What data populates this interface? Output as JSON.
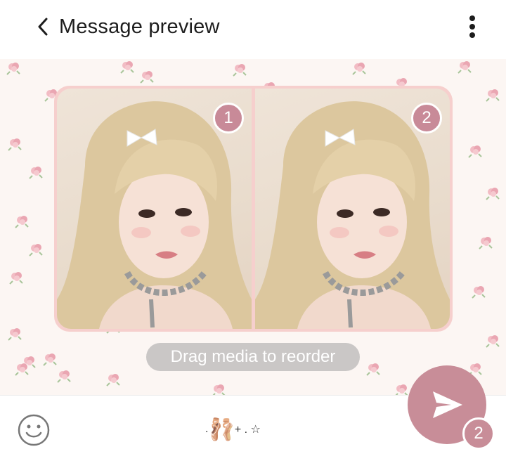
{
  "header": {
    "back_icon": "chevron-left-icon",
    "title": "Message preview",
    "menu_icon": "more-vertical-icon"
  },
  "media": {
    "items": [
      {
        "index": "1",
        "description": "selfie photo"
      },
      {
        "index": "2",
        "description": "selfie photo"
      }
    ],
    "hint": "Drag media to reorder"
  },
  "composer": {
    "emoji_icon": "smiley-icon",
    "text_prefix": ". ",
    "text_emoji": "🩰",
    "text_suffix": " + . ☆",
    "send_icon": "send-icon",
    "send_count": "2"
  },
  "colors": {
    "accent": "#c88d98",
    "wallpaper": "#fcf6f3",
    "frame": "#f6cfcd"
  }
}
